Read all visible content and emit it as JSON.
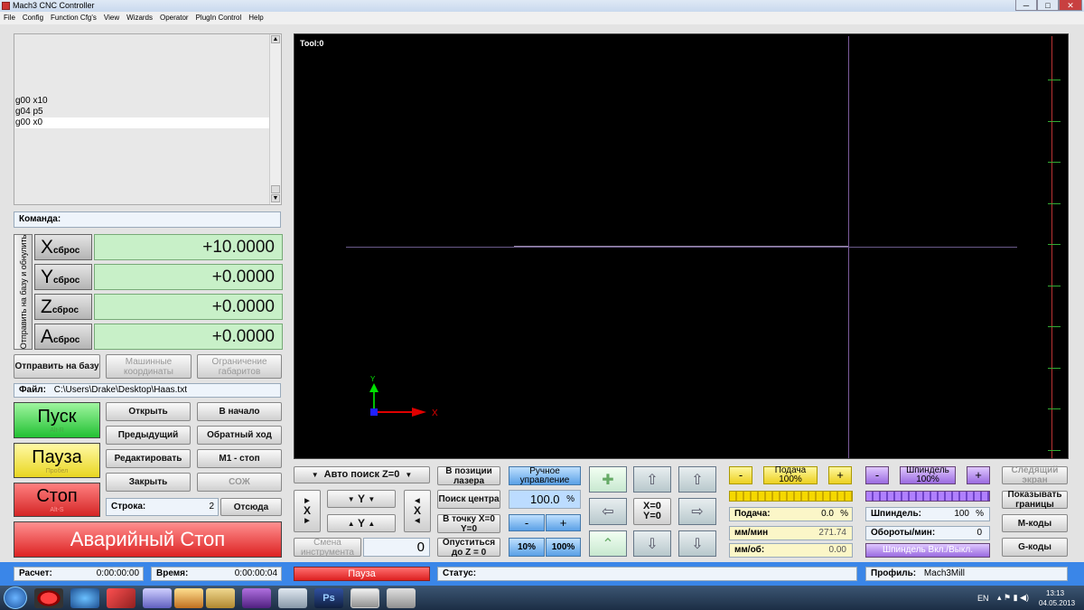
{
  "window": {
    "title": "Mach3 CNC Controller",
    "min": "─",
    "max": "□",
    "close": "✕"
  },
  "menu": [
    "File",
    "Config",
    "Function Cfg's",
    "View",
    "Wizards",
    "Operator",
    "PlugIn Control",
    "Help"
  ],
  "gcode": {
    "lines": [
      "g00 x10",
      "g04 p5",
      "g00 x0"
    ]
  },
  "command": {
    "label": "Команда:",
    "value": ""
  },
  "ref_all_label": "Отправить на базу и обнулить",
  "dro": [
    {
      "axis": "X",
      "reset": "сброс",
      "value": "+10.0000"
    },
    {
      "axis": "Y",
      "reset": "сброс",
      "value": "+0.0000"
    },
    {
      "axis": "Z",
      "reset": "сброс",
      "value": "+0.0000"
    },
    {
      "axis": "A",
      "reset": "сброс",
      "value": "+0.0000"
    }
  ],
  "buttons": {
    "ref_home": "Отправить на базу",
    "machine_coords": "Машинные координаты",
    "soft_limits": "Ограничение габаритов",
    "open": "Открыть",
    "rewind": "В начало",
    "prev": "Предыдущий",
    "reverse": "Обратный ход",
    "edit": "Редактировать",
    "m1_stop": "M1 - стоп",
    "close": "Закрыть",
    "cooling": "СОЖ",
    "from_here": "Отсюда",
    "auto_z": "Авто поиск Z=0",
    "laser_pos": "В позиции лазера",
    "find_center": "Поиск центра",
    "goto_zero": "В точку X=0 Y=0",
    "lower_z": "Опуститься до Z = 0",
    "manual_control": "Ручное управление",
    "tool_change": "Смена инструмента",
    "feed_minus": "-",
    "feed_plus": "+",
    "feed_pct": "Подача 100%",
    "spindle_minus": "-",
    "spindle_plus": "+",
    "spindle_pct": "Шпиндель 100%",
    "following": "Следящий экран",
    "show_limits": "Показывать границы",
    "m_codes": "M-коды",
    "g_codes": "G-коды",
    "spindle_toggle": "Шпиндель Вкл./Выкл.",
    "xy_zero": "X=0 Y=0",
    "pct10": "10%",
    "pct100": "100%",
    "jog_minus": "-",
    "jog_plus": "+"
  },
  "cycle": {
    "start": "Пуск",
    "start_hint": "Alt-R",
    "pause": "Пауза",
    "pause_hint": "Пробел",
    "stop": "Стоп",
    "stop_hint": "Alt-S",
    "estop": "Аварийный Стоп"
  },
  "file": {
    "label": "Файл:",
    "path": "C:\\Users\\Drake\\Desktop\\Haas.txt"
  },
  "line": {
    "label": "Строка:",
    "value": "2"
  },
  "tool": {
    "label": "Tool:0",
    "value": "0"
  },
  "y_label": "Y",
  "x_label": "X",
  "jog_value": "100.0",
  "jog_unit": "%",
  "feed": {
    "label": "Подача:",
    "value": "0.0",
    "unit": "%",
    "mm_min_label": "мм/мин",
    "mm_min": "271.74",
    "mm_rev_label": "мм/об:",
    "mm_rev": "0.00"
  },
  "spindle": {
    "label": "Шпиндель:",
    "value": "100",
    "unit": "%",
    "rpm_label": "Обороты/мин:",
    "rpm": "0"
  },
  "status": {
    "estimate_label": "Расчет:",
    "estimate": "0:00:00:00",
    "time_label": "Время:",
    "time": "0:00:00:04",
    "mode": "Пауза",
    "status_label": "Статус:",
    "status_text": "",
    "profile_label": "Профиль:",
    "profile": "Mach3Mill"
  },
  "taskbar": {
    "lang": "EN",
    "time": "13:13",
    "date": "04.05.2013"
  },
  "colors": {
    "dro_bg": "#c8f0c8",
    "start": "#22cc33",
    "pause": "#f0e030",
    "stop": "#e03030",
    "status_bar": "#3a86e8"
  }
}
